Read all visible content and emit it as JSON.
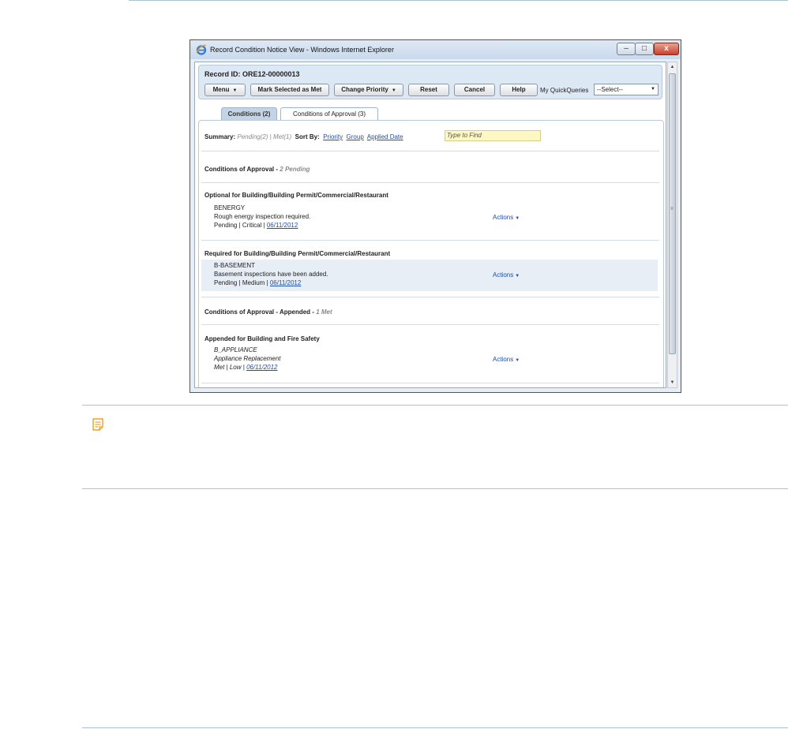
{
  "window": {
    "title": "Record Condition Notice View - Windows Internet Explorer",
    "min_label": "‒",
    "max_label": "□",
    "close_label": "x"
  },
  "header": {
    "record_id": "Record ID: ORE12-00000013"
  },
  "toolbar": {
    "menu": "Menu",
    "mark_met": "Mark Selected as Met",
    "change_priority": "Change Priority",
    "reset": "Reset",
    "cancel": "Cancel",
    "help": "Help",
    "quickqueries_label": "My QuickQueries",
    "quickqueries_value": "--Select--"
  },
  "tabs": [
    {
      "label": "Conditions (2)",
      "active": false
    },
    {
      "label": "Conditions of Approval (3)",
      "active": true
    }
  ],
  "summary": {
    "label": "Summary:",
    "pending": "Pending(2)",
    "divider": "|",
    "met": "Met(1)",
    "sort_label": "Sort By:",
    "sort_priority": "Priority",
    "sort_group": "Group",
    "sort_applied": "Applied Date",
    "find_placeholder": "Type to Find"
  },
  "sections": [
    {
      "title": "Conditions of Approval -",
      "count": "2 Pending"
    },
    {
      "title": "Conditions of Approval - Appended -",
      "count": "1 Met"
    }
  ],
  "groups": [
    {
      "title": "Optional for Building/Building Permit/Commercial/Restaurant",
      "condition": {
        "code": "BENERGY",
        "description": "Rough energy inspection required.",
        "status": "Pending | Critical | ",
        "date": "06/11/2012",
        "actions": "Actions"
      }
    },
    {
      "title": "Required for Building/Building Permit/Commercial/Restaurant",
      "condition": {
        "code": "B-BASEMENT",
        "description": "Basement inspections have been added.",
        "status": "Pending | Medium | ",
        "date": "06/11/2012",
        "actions": "Actions"
      }
    },
    {
      "title": "Appended for Building and Fire Safety",
      "condition": {
        "code": "B_APPLIANCE",
        "description": "Appliance Replacement",
        "status": "Met | Low | ",
        "date": "06/11/2012",
        "actions": "Actions"
      }
    }
  ],
  "icons": {
    "browser": "internet-explorer-icon",
    "note": "note-icon",
    "dropdown": "triangle-down-icon"
  },
  "colors": {
    "accent_link": "#1f4fa8",
    "highlight_row": "#e8eef6",
    "find_box": "#fdf7c4",
    "note_icon": "#f0a020"
  }
}
